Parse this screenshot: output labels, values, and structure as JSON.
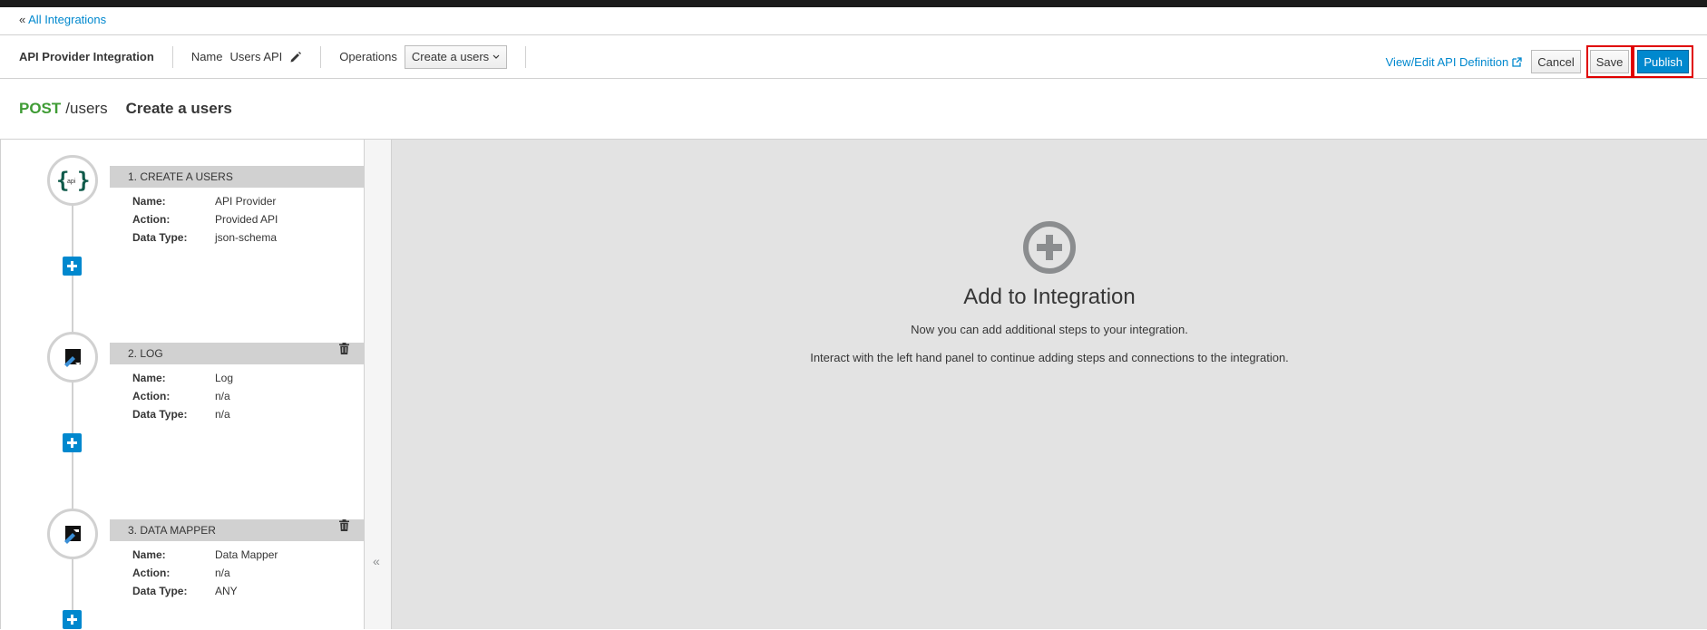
{
  "breadcrumb": {
    "prefix": "«",
    "link_label": "All Integrations"
  },
  "header": {
    "title": "API Provider Integration",
    "name_label": "Name",
    "name_value": "Users API",
    "operations_label": "Operations",
    "operations_selected": "Create a users",
    "view_edit_label": "View/Edit API Definition",
    "cancel_label": "Cancel",
    "save_label": "Save",
    "publish_label": "Publish"
  },
  "operation": {
    "verb": "POST",
    "path": "/users",
    "name": "Create a users"
  },
  "steps": [
    {
      "title": "1. CREATE A USERS",
      "icon": "api-icon",
      "name_key": "Name:",
      "name": "API Provider",
      "action_key": "Action:",
      "action": "Provided API",
      "type_key": "Data Type:",
      "type": "json-schema"
    },
    {
      "title": "2. LOG",
      "icon": "log-icon",
      "name_key": "Name:",
      "name": "Log",
      "action_key": "Action:",
      "action": "n/a",
      "type_key": "Data Type:",
      "type": "n/a"
    },
    {
      "title": "3. DATA MAPPER",
      "icon": "data-mapper-icon",
      "name_key": "Name:",
      "name": "Data Mapper",
      "action_key": "Action:",
      "action": "n/a",
      "type_key": "Data Type:",
      "type": "ANY"
    }
  ],
  "collapse_glyph": "«",
  "empty_state": {
    "icon": "plus-circle-icon",
    "title": "Add to Integration",
    "line1": "Now you can add additional steps to your integration.",
    "line2": "Interact with the left hand panel to continue adding steps and connections to the integration."
  },
  "colors": {
    "accent": "#0088ce",
    "verb": "#3f9c35",
    "highlight": "#e00000"
  }
}
